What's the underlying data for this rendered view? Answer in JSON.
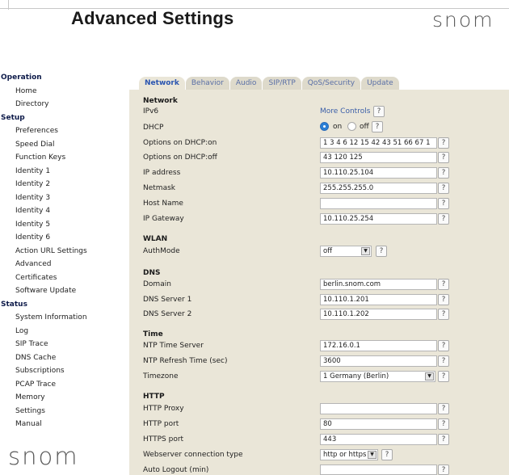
{
  "header": {
    "title": "Advanced Settings",
    "logo_text": "snom"
  },
  "sidebar": {
    "sections": [
      {
        "title": "Operation",
        "items": [
          "Home",
          "Directory"
        ]
      },
      {
        "title": "Setup",
        "items": [
          "Preferences",
          "Speed Dial",
          "Function Keys",
          "Identity 1",
          "Identity 2",
          "Identity 3",
          "Identity 4",
          "Identity 5",
          "Identity 6",
          "Action URL Settings",
          "Advanced",
          "Certificates",
          "Software Update"
        ]
      },
      {
        "title": "Status",
        "items": [
          "System Information",
          "Log",
          "SIP Trace",
          "DNS Cache",
          "Subscriptions",
          "PCAP Trace",
          "Memory",
          "Settings",
          "Manual"
        ]
      }
    ]
  },
  "tabs": [
    "Network",
    "Behavior",
    "Audio",
    "SIP/RTP",
    "QoS/Security",
    "Update"
  ],
  "active_tab": "Network",
  "help_label": "?",
  "network": {
    "section_title": "Network",
    "ipv6_label": "IPv6",
    "more_controls": "More Controls",
    "dhcp_label": "DHCP",
    "dhcp_on": "on",
    "dhcp_off": "off",
    "dhcp_value": "on",
    "options_on_label": "Options on DHCP:on",
    "options_on_value": "1 3 4 6 12 15 42 43 51 66 67 1",
    "options_off_label": "Options on DHCP:off",
    "options_off_value": "43 120 125",
    "ip_label": "IP address",
    "ip_value": "10.110.25.104",
    "netmask_label": "Netmask",
    "netmask_value": "255.255.255.0",
    "hostname_label": "Host Name",
    "hostname_value": "",
    "gateway_label": "IP Gateway",
    "gateway_value": "10.110.25.254"
  },
  "wlan": {
    "section_title": "WLAN",
    "authmode_label": "AuthMode",
    "authmode_value": "off"
  },
  "dns": {
    "section_title": "DNS",
    "domain_label": "Domain",
    "domain_value": "berlin.snom.com",
    "server1_label": "DNS Server 1",
    "server1_value": "10.110.1.201",
    "server2_label": "DNS Server 2",
    "server2_value": "10.110.1.202"
  },
  "time": {
    "section_title": "Time",
    "ntp_label": "NTP Time Server",
    "ntp_value": "172.16.0.1",
    "refresh_label": "NTP Refresh Time (sec)",
    "refresh_value": "3600",
    "timezone_label": "Timezone",
    "timezone_value": "1 Germany (Berlin)"
  },
  "http": {
    "section_title": "HTTP",
    "proxy_label": "HTTP Proxy",
    "proxy_value": "",
    "port_label": "HTTP port",
    "port_value": "80",
    "https_port_label": "HTTPS port",
    "https_port_value": "443",
    "conn_type_label": "Webserver connection type",
    "conn_type_value": "http or https",
    "autologout_label": "Auto Logout (min)",
    "autologout_value": ""
  }
}
